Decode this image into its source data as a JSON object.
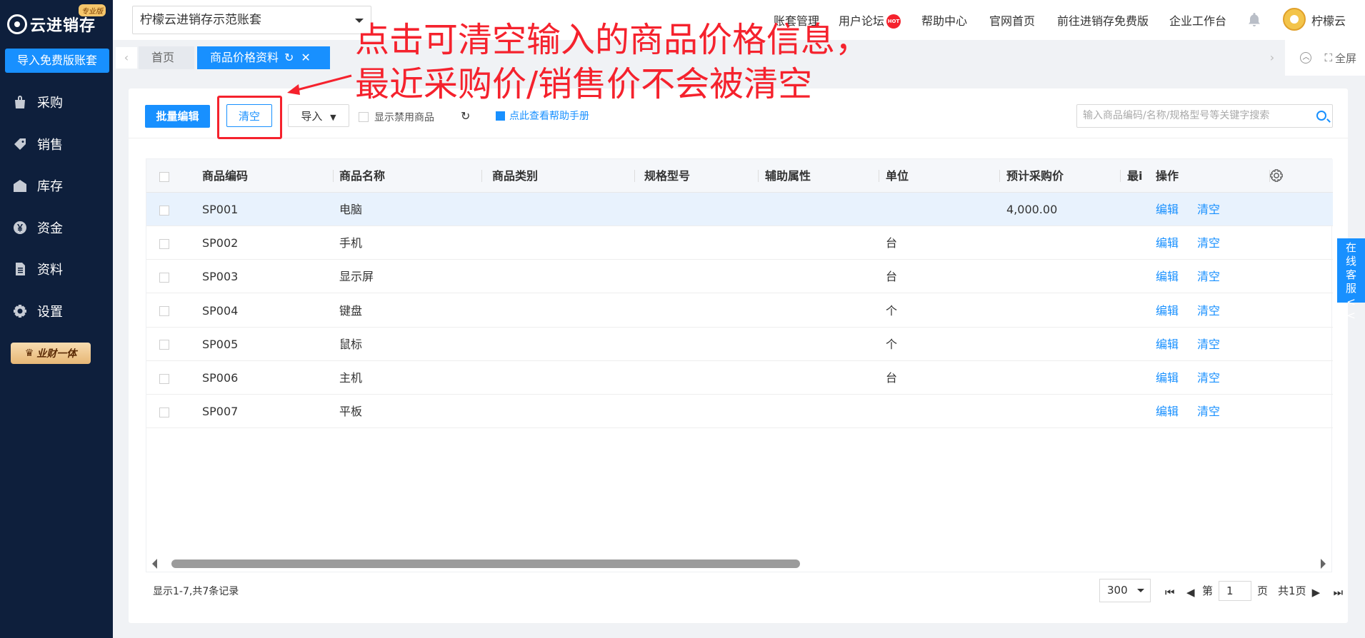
{
  "app": {
    "name": "云进销存",
    "edition": "专业版"
  },
  "sidebar": {
    "import_free": "导入免费版账套",
    "items": [
      {
        "label": "采购",
        "icon": "bag-icon"
      },
      {
        "label": "销售",
        "icon": "tag-icon"
      },
      {
        "label": "库存",
        "icon": "warehouse-icon"
      },
      {
        "label": "资金",
        "icon": "yen-icon"
      },
      {
        "label": "资料",
        "icon": "document-icon"
      },
      {
        "label": "设置",
        "icon": "gear-icon"
      }
    ],
    "vip": "业财一体"
  },
  "header": {
    "account": "柠檬云进销存示范账套",
    "links": [
      "账套管理",
      "用户论坛",
      "帮助中心",
      "官网首页",
      "前往进销存免费版",
      "企业工作台"
    ],
    "hot": "HOT",
    "username": "柠檬云"
  },
  "tabs": {
    "home": "首页",
    "active": "商品价格资料",
    "fullscreen": "全屏"
  },
  "toolbar": {
    "batch_edit": "批量编辑",
    "clear": "清空",
    "import": "导入",
    "show_disabled": "显示禁用商品",
    "help": "点此查看帮助手册",
    "search_placeholder": "输入商品编码/名称/规格型号等关键字搜索"
  },
  "annotation": {
    "line1": "点击可清空输入的商品价格信息，",
    "line2": "最近采购价/销售价不会被清空"
  },
  "table": {
    "columns": [
      "商品编码",
      "商品名称",
      "商品类别",
      "规格型号",
      "辅助属性",
      "单位",
      "预计采购价",
      "最i",
      "操作"
    ],
    "rows": [
      {
        "code": "SP001",
        "name": "电脑",
        "unit": "",
        "price": "4,000.00"
      },
      {
        "code": "SP002",
        "name": "手机",
        "unit": "台",
        "price": ""
      },
      {
        "code": "SP003",
        "name": "显示屏",
        "unit": "台",
        "price": ""
      },
      {
        "code": "SP004",
        "name": "键盘",
        "unit": "个",
        "price": ""
      },
      {
        "code": "SP005",
        "name": "鼠标",
        "unit": "个",
        "price": ""
      },
      {
        "code": "SP006",
        "name": "主机",
        "unit": "台",
        "price": ""
      },
      {
        "code": "SP007",
        "name": "平板",
        "unit": "",
        "price": ""
      }
    ],
    "edit": "编辑",
    "clear": "清空"
  },
  "footer": {
    "info": "显示1-7,共7条记录",
    "page_size": "300",
    "page_prefix": "第",
    "page": "1",
    "page_suffix": "页",
    "total_pages": "共1页"
  },
  "service": {
    "text": "在线客服<<"
  }
}
